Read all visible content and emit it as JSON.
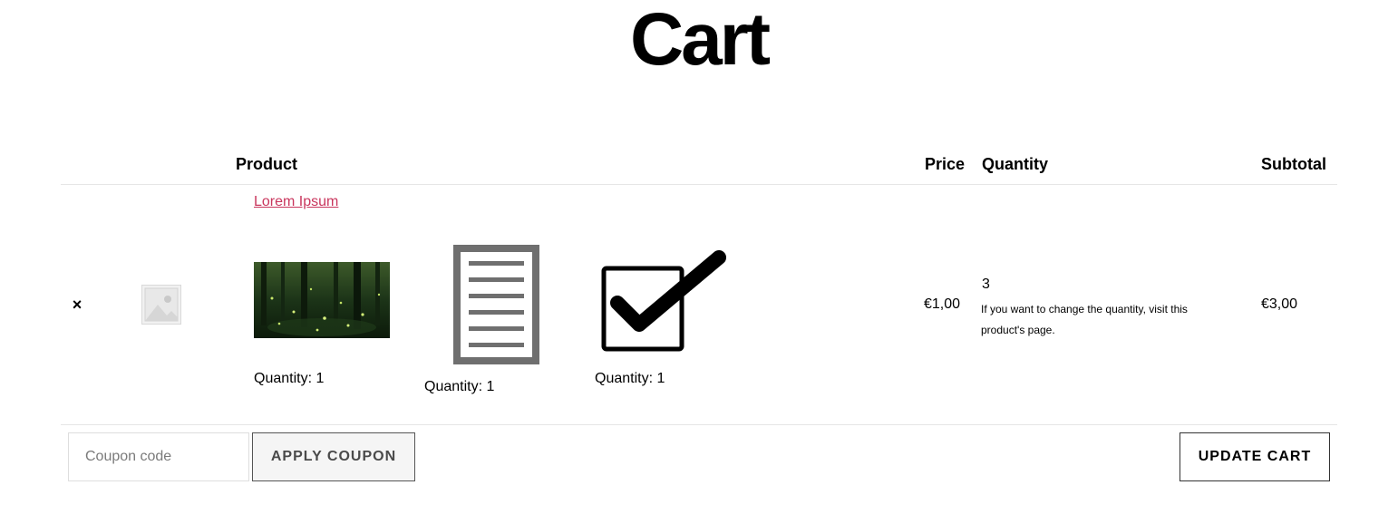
{
  "page": {
    "title": "Cart"
  },
  "table": {
    "headers": {
      "product": "Product",
      "price": "Price",
      "quantity": "Quantity",
      "subtotal": "Subtotal"
    }
  },
  "cart_item": {
    "remove_label": "×",
    "product_name": "Lorem Ipsum",
    "price": "€1,00",
    "quantity": "3",
    "quantity_note": "If you want to change the quantity, visit this product's page.",
    "subtotal": "€3,00",
    "bundle_items": [
      {
        "icon": "forest-photo",
        "quantity_label": "Quantity: 1"
      },
      {
        "icon": "document-icon",
        "quantity_label": "Quantity: 1"
      },
      {
        "icon": "checkbox-checkmark-icon",
        "quantity_label": "Quantity: 1"
      }
    ]
  },
  "actions": {
    "coupon_placeholder": "Coupon code",
    "coupon_value": "",
    "apply_coupon_label": "Apply coupon",
    "update_cart_label": "Update cart"
  },
  "colors": {
    "link": "#c9365d",
    "divider": "#e6e6e6",
    "apply_button_bg": "#f5f5f5"
  }
}
